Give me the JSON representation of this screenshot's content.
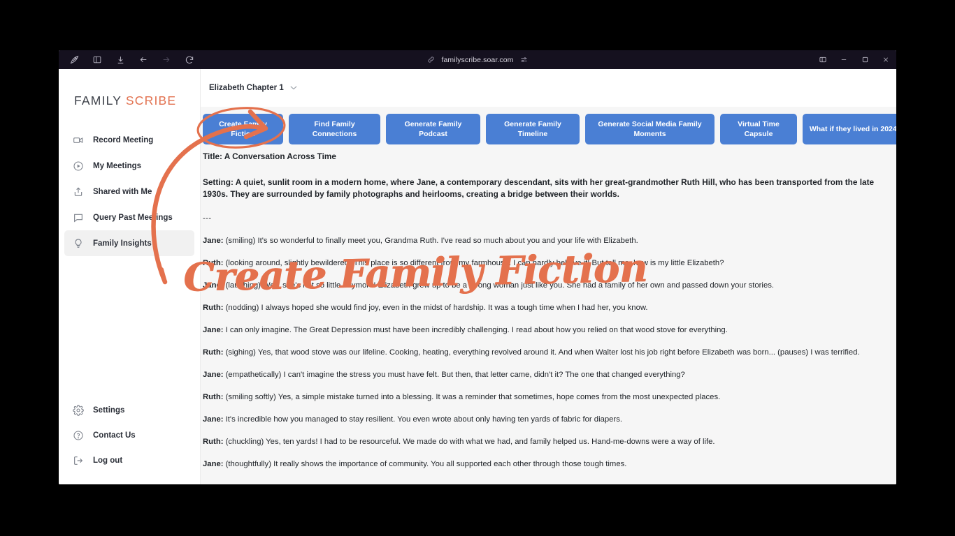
{
  "browser": {
    "toolbar_icons": [
      "browser-logo-icon",
      "sidebar-toggle-icon",
      "downloads-icon",
      "back-icon",
      "forward-icon",
      "reload-icon"
    ],
    "url": "familyscribe.soar.com",
    "url_shield_icon": "link-icon",
    "url_settings_icon": "sliders-icon",
    "window_controls": [
      "split-view-icon",
      "minimize-icon",
      "maximize-icon",
      "close-icon"
    ]
  },
  "sidebar": {
    "logo": {
      "primary": "FAMILY",
      "accent": "SCRIBE"
    },
    "items": [
      {
        "label": "Record Meeting",
        "icon": "video-camera-icon",
        "active": false
      },
      {
        "label": "My Meetings",
        "icon": "play-circle-icon",
        "active": false
      },
      {
        "label": "Shared with Me",
        "icon": "share-upload-icon",
        "active": false
      },
      {
        "label": "Query Past Meetings",
        "icon": "chat-bubble-icon",
        "active": false
      },
      {
        "label": "Family Insights",
        "icon": "lightbulb-icon",
        "active": true
      }
    ],
    "bottom_items": [
      {
        "label": "Settings",
        "icon": "gear-icon"
      },
      {
        "label": "Contact Us",
        "icon": "question-circle-icon"
      },
      {
        "label": "Log out",
        "icon": "logout-icon"
      }
    ]
  },
  "topbar": {
    "chapter": "Elizabeth Chapter 1",
    "caret_icon": "chevron-down-icon"
  },
  "actions": [
    "Create Family Fiction",
    "Find Family Connections",
    "Generate Family Podcast",
    "Generate Family Timeline",
    "Generate Social Media Family Moments",
    "Virtual Time Capsule",
    "What if they lived in 2024?"
  ],
  "document": {
    "title": "Title: A Conversation Across Time",
    "setting": "Setting: A quiet, sunlit room in a modern home, where Jane, a contemporary descendant, sits with her great-grandmother Ruth Hill, who has been transported from the late 1930s. They are surrounded by family photographs and heirlooms, creating a bridge between their worlds.",
    "divider": "---",
    "dialogue": [
      {
        "speaker": "Jane:",
        "text": " (smiling) It's so wonderful to finally meet you, Grandma Ruth. I've read so much about you and your life with Elizabeth."
      },
      {
        "speaker": "Ruth:",
        "text": " (looking around, slightly bewildered) This place is so different from my farmhouse. I can hardly believe it! But tell me, how is my little Elizabeth?"
      },
      {
        "speaker": "Jane:",
        "text": " (laughing) Well, she's not so little anymore! Elizabeth grew up to be a strong woman just like you. She had a family of her own and passed down your stories."
      },
      {
        "speaker": "Ruth:",
        "text": " (nodding) I always hoped she would find joy, even in the midst of hardship. It was a tough time when I had her, you know."
      },
      {
        "speaker": "Jane:",
        "text": " I can only imagine. The Great Depression must have been incredibly challenging. I read about how you relied on that wood stove for everything."
      },
      {
        "speaker": "Ruth:",
        "text": " (sighing) Yes, that wood stove was our lifeline. Cooking, heating, everything revolved around it. And when Walter lost his job right before Elizabeth was born... (pauses) I was terrified."
      },
      {
        "speaker": "Jane:",
        "text": " (empathetically) I can't imagine the stress you must have felt. But then, that letter came, didn't it? The one that changed everything?"
      },
      {
        "speaker": "Ruth:",
        "text": " (smiling softly) Yes, a simple mistake turned into a blessing. It was a reminder that sometimes, hope comes from the most unexpected places."
      },
      {
        "speaker": "Jane:",
        "text": " It's incredible how you managed to stay resilient. You even wrote about only having ten yards of fabric for diapers."
      },
      {
        "speaker": "Ruth:",
        "text": " (chuckling) Yes, ten yards! I had to be resourceful. We made do with what we had, and family helped us. Hand-me-downs were a way of life."
      },
      {
        "speaker": "Jane:",
        "text": " (thoughtfully) It really shows the importance of community. You all supported each other through those tough times."
      }
    ]
  },
  "annotation": {
    "handwritten_label": "Create Family Fiction",
    "color": "#e4714d",
    "shapes": [
      "ellipse-highlight-around-create-family-fiction-button",
      "curved-arrow-pointing-to-button"
    ]
  }
}
